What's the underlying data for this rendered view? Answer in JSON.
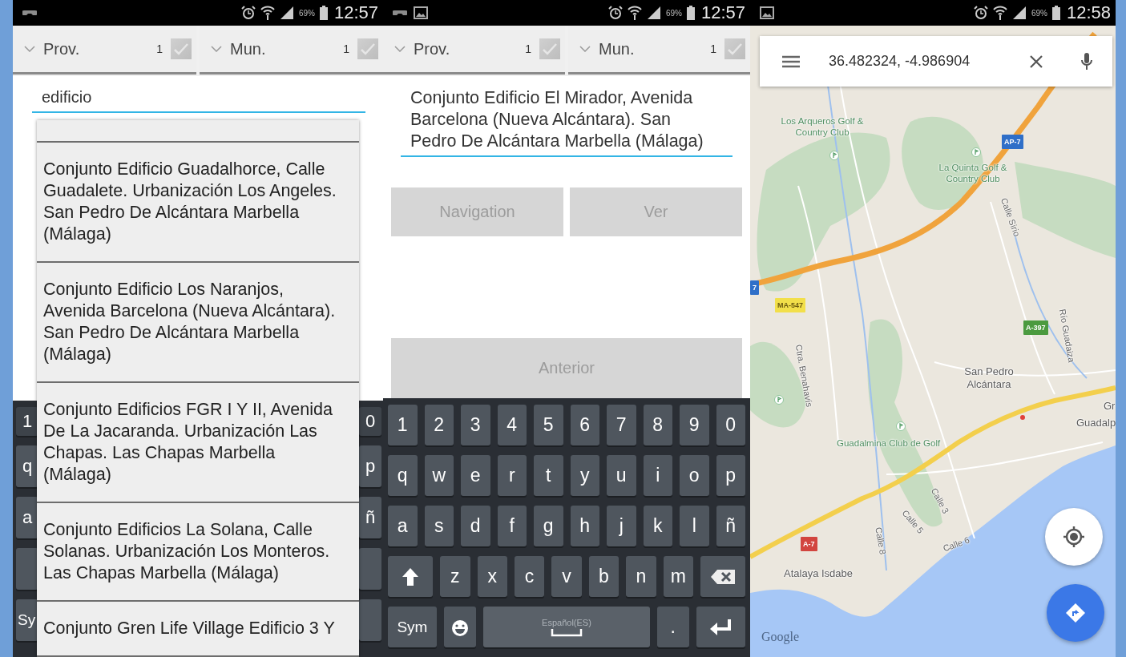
{
  "search_screen": {
    "status_bar": {
      "battery": "69%",
      "time": "12:57"
    },
    "filters": [
      {
        "label": "Prov.",
        "count": "1",
        "checked": true
      },
      {
        "label": "Mun.",
        "count": "1",
        "checked": true
      }
    ],
    "search_field": {
      "value": "edificio"
    },
    "suggestions": [
      "Conjunto Edificio Guadalhorce, Calle Guadalete. Urbanización Los Angeles. San Pedro De Alcántara Marbella (Málaga)",
      "Conjunto Edificio Los Naranjos, Avenida Barcelona (Nueva Alcántara). San Pedro De Alcántara Marbella (Málaga)",
      "Conjunto Edificios FGR  I Y II, Avenida De La Jacaranda. Urbanización Las Chapas. Las Chapas Marbella (Málaga)",
      "Conjunto Edificios La Solana, Calle Solanas. Urbanización Los Monteros. Las Chapas Marbella (Málaga)",
      "Conjunto Gren Life Village Edificio 3 Y"
    ],
    "keyboard_edge": {
      "left": [
        {
          "kind": "char",
          "label": "1"
        },
        {
          "kind": "char",
          "label": "q"
        },
        {
          "kind": "char",
          "label": "a"
        },
        {
          "kind": "shift"
        },
        {
          "kind": "sym",
          "label": "Sy"
        }
      ],
      "right": [
        {
          "kind": "char",
          "label": "0"
        },
        {
          "kind": "char",
          "label": "p"
        },
        {
          "kind": "char",
          "label": "ñ"
        },
        {
          "kind": "backspace"
        },
        {
          "kind": "enter"
        }
      ]
    }
  },
  "detail_screen": {
    "status_bar": {
      "battery": "69%",
      "time": "12:57"
    },
    "filters": [
      {
        "label": "Prov.",
        "count": "1",
        "checked": true
      },
      {
        "label": "Mun.",
        "count": "1",
        "checked": true
      }
    ],
    "address": "Conjunto Edificio El Mirador, Avenida Barcelona (Nueva Alcántara). San Pedro De Alcántara Marbella (Málaga)",
    "buttons": [
      {
        "label": "Navigation",
        "disabled": true
      },
      {
        "label": "Ver",
        "disabled": true
      }
    ],
    "back_button": {
      "label": "Anterior",
      "disabled": true
    },
    "keyboard": {
      "number_row": [
        {
          "kind": "char",
          "label": "1"
        },
        {
          "kind": "char",
          "label": "2"
        },
        {
          "kind": "char",
          "label": "3"
        },
        {
          "kind": "char",
          "label": "4"
        },
        {
          "kind": "char",
          "label": "5"
        },
        {
          "kind": "char",
          "label": "6"
        },
        {
          "kind": "char",
          "label": "7"
        },
        {
          "kind": "char",
          "label": "8"
        },
        {
          "kind": "char",
          "label": "9"
        },
        {
          "kind": "char",
          "label": "0"
        }
      ],
      "top_letter_row": [
        {
          "kind": "char",
          "label": "q"
        },
        {
          "kind": "char",
          "label": "w"
        },
        {
          "kind": "char",
          "label": "e"
        },
        {
          "kind": "char",
          "label": "r"
        },
        {
          "kind": "char",
          "label": "t"
        },
        {
          "kind": "char",
          "label": "y"
        },
        {
          "kind": "char",
          "label": "u"
        },
        {
          "kind": "char",
          "label": "i"
        },
        {
          "kind": "char",
          "label": "o"
        },
        {
          "kind": "char",
          "label": "p"
        }
      ],
      "middle_letter_row": [
        {
          "kind": "char",
          "label": "a"
        },
        {
          "kind": "char",
          "label": "s"
        },
        {
          "kind": "char",
          "label": "d"
        },
        {
          "kind": "char",
          "label": "f"
        },
        {
          "kind": "char",
          "label": "g"
        },
        {
          "kind": "char",
          "label": "h"
        },
        {
          "kind": "char",
          "label": "j"
        },
        {
          "kind": "char",
          "label": "k"
        },
        {
          "kind": "char",
          "label": "l"
        },
        {
          "kind": "char",
          "label": "ñ"
        }
      ],
      "bottom_letter_row": [
        {
          "kind": "shift"
        },
        {
          "kind": "char",
          "label": "z"
        },
        {
          "kind": "char",
          "label": "x"
        },
        {
          "kind": "char",
          "label": "c"
        },
        {
          "kind": "char",
          "label": "v"
        },
        {
          "kind": "char",
          "label": "b"
        },
        {
          "kind": "char",
          "label": "n"
        },
        {
          "kind": "char",
          "label": "m"
        },
        {
          "kind": "backspace"
        }
      ],
      "function_row": [
        {
          "kind": "sym",
          "label": "Sym"
        },
        {
          "kind": "emoji"
        },
        {
          "kind": "space",
          "label": "Español(ES)"
        },
        {
          "kind": "period",
          "label": "."
        },
        {
          "kind": "enter"
        }
      ]
    }
  },
  "map_screen": {
    "status_bar": {
      "battery": "69%",
      "time": "12:58"
    },
    "search": {
      "value": "36.482324, -4.986904"
    },
    "labels": [
      {
        "text": "Los Arqueros Golf & Country Club",
        "kind": "golf"
      },
      {
        "text": "La Quinta Golf & Country Club",
        "kind": "golf"
      },
      {
        "text": "Calle Sirio",
        "kind": "street"
      },
      {
        "text": "AP-7",
        "kind": "shield",
        "color": "#2f6fc8"
      },
      {
        "text": "7",
        "kind": "shield",
        "color": "#2f6fc8"
      },
      {
        "text": "MA-547",
        "kind": "shield",
        "color": "#f2df4a"
      },
      {
        "text": "A-397",
        "kind": "shield",
        "color": "#4b9a3f"
      },
      {
        "text": "Río Guadaiza",
        "kind": "street"
      },
      {
        "text": "Ctra. Benahavís",
        "kind": "street"
      },
      {
        "text": "San Pedro Alcántara",
        "kind": "place"
      },
      {
        "text": "Gr",
        "kind": "place"
      },
      {
        "text": "Guadalp",
        "kind": "place"
      },
      {
        "text": "Guadalmina Club de Golf",
        "kind": "golf"
      },
      {
        "text": "Calle 3",
        "kind": "street"
      },
      {
        "text": "Calle 5",
        "kind": "street"
      },
      {
        "text": "Calle 6",
        "kind": "street"
      },
      {
        "text": "Calle 8",
        "kind": "street"
      },
      {
        "text": "A-7",
        "kind": "shield",
        "color": "#d2453f"
      },
      {
        "text": "Atalaya Isdabe",
        "kind": "place"
      }
    ],
    "attribution": "Google"
  }
}
